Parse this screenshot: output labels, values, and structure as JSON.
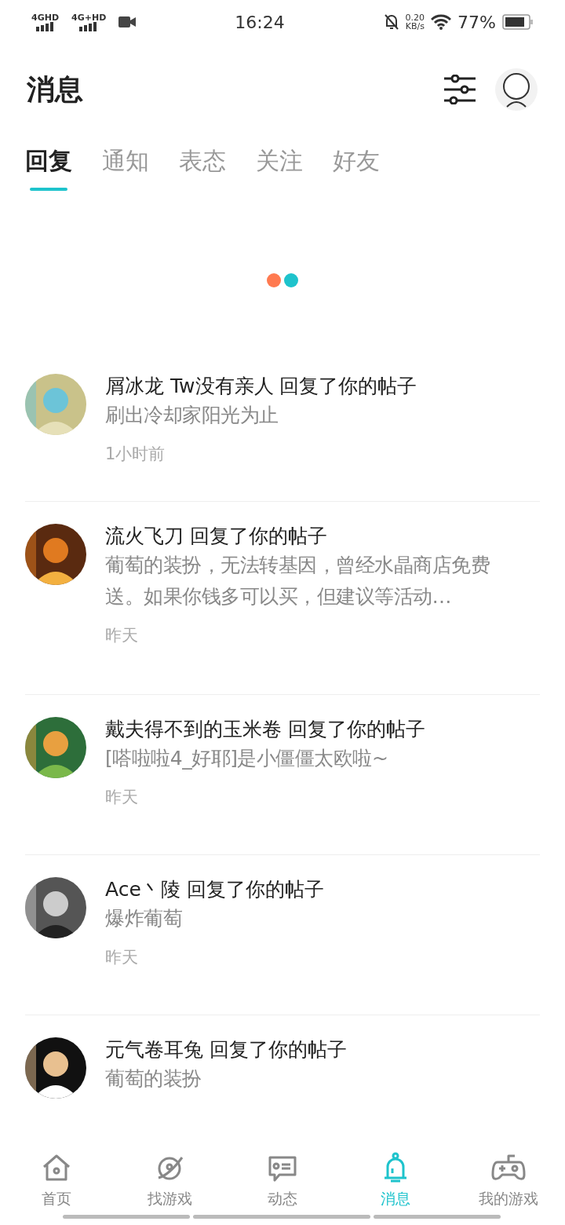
{
  "status_bar": {
    "network_1": "4G",
    "network_1_tag": "HD",
    "network_2": "4G+",
    "network_2_tag": "HD",
    "time": "16:24",
    "speed": "0.20",
    "speed_unit": "KB/s",
    "battery": "77%"
  },
  "header": {
    "title": "消息"
  },
  "tabs": [
    {
      "label": "回复",
      "selected": true
    },
    {
      "label": "通知",
      "selected": false
    },
    {
      "label": "表态",
      "selected": false
    },
    {
      "label": "关注",
      "selected": false
    },
    {
      "label": "好友",
      "selected": false
    }
  ],
  "loading": {
    "dots": [
      {
        "color": "#ff7a50"
      },
      {
        "color": "#1ec3cc"
      }
    ]
  },
  "messages": [
    {
      "title": "屑冰龙 Tw没有亲人 回复了你的帖子",
      "body": "刷出冷却家阳光为止",
      "time": "1小时前"
    },
    {
      "title": "流火飞刀 回复了你的帖子",
      "body": "葡萄的装扮，无法转基因，曾经水晶商店免费送。如果你钱多可以买，但建议等活动…",
      "time": "昨天"
    },
    {
      "title": "戴夫得不到的玉米卷 回复了你的帖子",
      "body": "[嗒啦啦4_好耶]是小僵僵太欧啦~",
      "time": "昨天"
    },
    {
      "title": "Ace丶陵 回复了你的帖子",
      "body": "爆炸葡萄",
      "time": "昨天"
    },
    {
      "title": "元气卷耳兔 回复了你的帖子",
      "body": "葡萄的装扮"
    }
  ],
  "bottom_nav": [
    {
      "label": "首页",
      "selected": false
    },
    {
      "label": "找游戏",
      "selected": false
    },
    {
      "label": "动态",
      "selected": false
    },
    {
      "label": "消息",
      "selected": true
    },
    {
      "label": "我的游戏",
      "selected": false
    }
  ]
}
